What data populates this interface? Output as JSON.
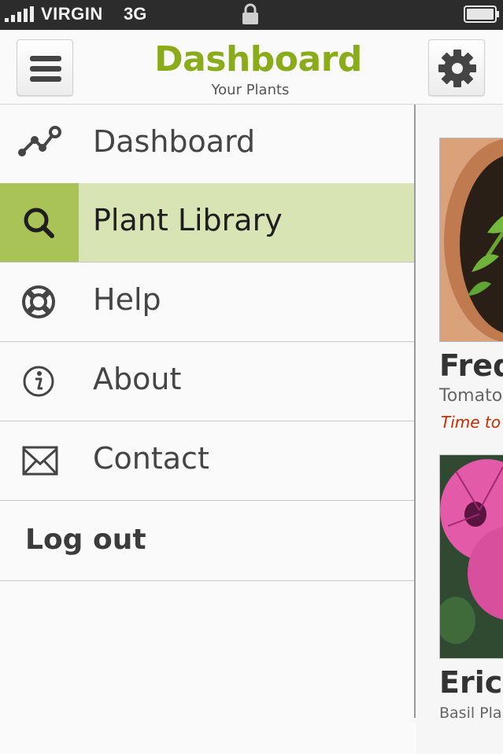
{
  "status_bar": {
    "carrier": "VIRGIN",
    "network": "3G",
    "icons": [
      "signal-icon",
      "lock-icon",
      "battery-icon"
    ]
  },
  "header": {
    "title": "Dashboard",
    "subtitle": "Your Plants",
    "menu_icon": "hamburger-icon",
    "settings_icon": "gear-icon",
    "title_color": "#8aac1a"
  },
  "sidebar": {
    "items": [
      {
        "label": "Dashboard",
        "icon": "line-chart-icon",
        "active": false
      },
      {
        "label": "Plant Library",
        "icon": "search-icon",
        "active": true
      },
      {
        "label": "Help",
        "icon": "lifebuoy-icon",
        "active": false
      },
      {
        "label": "About",
        "icon": "info-icon",
        "active": false
      },
      {
        "label": "Contact",
        "icon": "envelope-icon",
        "active": false
      }
    ],
    "logout_label": "Log out",
    "active_color": "#d8e4b3",
    "active_icon_color": "#a9c356"
  },
  "plants": [
    {
      "name": "Fred",
      "type": "Tomato",
      "alert": "Time to w"
    },
    {
      "name": "Erica",
      "type": "Basil Pla"
    }
  ]
}
